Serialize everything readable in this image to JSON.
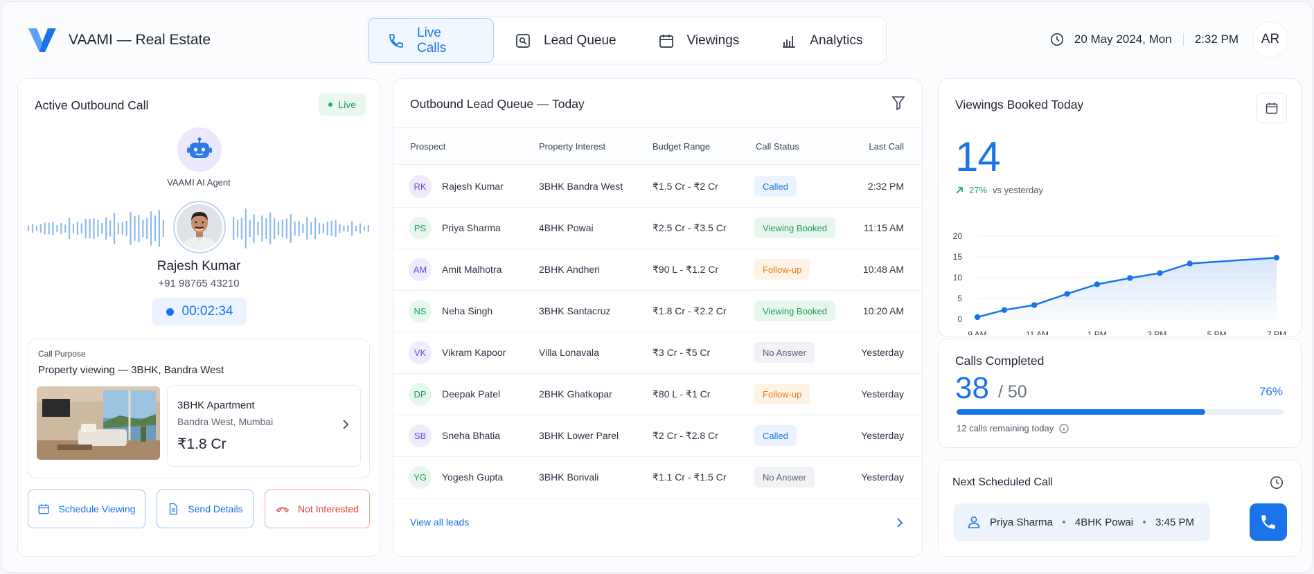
{
  "brand": {
    "name": "VAAMI — Real Estate",
    "accent": "#1a73e8"
  },
  "nav": {
    "tabs": [
      {
        "label": "Live Calls",
        "icon": "phone-icon",
        "active": true
      },
      {
        "label": "Lead Queue",
        "icon": "image-search-icon",
        "active": false
      },
      {
        "label": "Viewings",
        "icon": "calendar-icon",
        "active": false
      },
      {
        "label": "Analytics",
        "icon": "bar-chart-icon",
        "active": false
      }
    ]
  },
  "header": {
    "date": "20 May 2024, Mon",
    "time": "2:32 PM",
    "user_initials": "AR"
  },
  "active_call": {
    "title": "Active Outbound Call",
    "status": "Live",
    "agent_label": "VAAMI AI Agent",
    "caller_name": "Rajesh Kumar",
    "caller_phone": "+91 98765 43210",
    "duration": "00:02:34",
    "purpose_label": "Call Purpose",
    "purpose": "Property viewing — 3BHK, Bandra West",
    "property": {
      "title": "3BHK Apartment",
      "location": "Bandra West, Mumbai",
      "price": "₹1.8 Cr"
    },
    "actions": {
      "schedule": "Schedule Viewing",
      "send": "Send Details",
      "reject": "Not Interested"
    }
  },
  "queue": {
    "title": "Outbound Lead Queue — Today",
    "columns": [
      "Prospect",
      "Property Interest",
      "Budget Range",
      "Call Status",
      "Last Call"
    ],
    "rows": [
      {
        "initials": "RK",
        "name": "Rajesh Kumar",
        "property": "3BHK Bandra West",
        "budget": "₹1.5 Cr - ₹2 Cr",
        "status": "Called",
        "last": "2:32 PM"
      },
      {
        "initials": "PS",
        "name": "Priya Sharma",
        "property": "4BHK Powai",
        "budget": "₹2.5 Cr - ₹3.5 Cr",
        "status": "Viewing Booked",
        "last": "11:15 AM"
      },
      {
        "initials": "AM",
        "name": "Amit Malhotra",
        "property": "2BHK Andheri",
        "budget": "₹90 L - ₹1.2 Cr",
        "status": "Follow-up",
        "last": "10:48 AM"
      },
      {
        "initials": "NS",
        "name": "Neha Singh",
        "property": "3BHK Santacruz",
        "budget": "₹1.8 Cr - ₹2.2 Cr",
        "status": "Viewing Booked",
        "last": "10:20 AM"
      },
      {
        "initials": "VK",
        "name": "Vikram Kapoor",
        "property": "Villa Lonavala",
        "budget": "₹3 Cr - ₹5 Cr",
        "status": "No Answer",
        "last": "Yesterday"
      },
      {
        "initials": "DP",
        "name": "Deepak Patel",
        "property": "2BHK Ghatkopar",
        "budget": "₹80 L - ₹1 Cr",
        "status": "Follow-up",
        "last": "Yesterday"
      },
      {
        "initials": "SB",
        "name": "Sneha Bhatia",
        "property": "3BHK Lower Parel",
        "budget": "₹2 Cr - ₹2.8 Cr",
        "status": "Called",
        "last": "Yesterday"
      },
      {
        "initials": "YG",
        "name": "Yogesh Gupta",
        "property": "3BHK Borivali",
        "budget": "₹1.1 Cr - ₹1.5 Cr",
        "status": "No Answer",
        "last": "Yesterday"
      }
    ],
    "view_all": "View all leads",
    "status_colors": {
      "Called": {
        "bg": "#eaf3ff",
        "fg": "#1a73e8"
      },
      "Viewing Booked": {
        "bg": "#e8f7ee",
        "fg": "#1d9d57"
      },
      "Follow-up": {
        "bg": "#fff3e6",
        "fg": "#e07a1a"
      },
      "No Answer": {
        "bg": "#f1f2f5",
        "fg": "#5a6272"
      }
    }
  },
  "viewings": {
    "title": "Viewings Booked Today",
    "value": "14",
    "change": "27%",
    "change_label": "vs yesterday"
  },
  "chart_data": {
    "type": "area",
    "x": [
      "9 AM",
      "10 AM",
      "11 AM",
      "12 PM",
      "1 PM",
      "2 PM",
      "3 PM",
      "4 PM",
      "5 PM",
      "6 PM",
      "7 PM"
    ],
    "values": [
      0.5,
      2.2,
      3.4,
      6.1,
      8.4,
      9.9,
      11.1,
      13.4,
      14.8
    ],
    "point_hours": [
      9,
      10,
      11,
      12,
      13,
      14,
      15,
      16,
      17.5,
      19
    ],
    "tick_labels": [
      "9 AM",
      "11 AM",
      "1 PM",
      "3 PM",
      "5 PM",
      "7 PM"
    ],
    "yticks": [
      0,
      5,
      10,
      15,
      20
    ],
    "ylim": [
      0,
      20
    ],
    "grid": true,
    "color": "#1a73e8"
  },
  "calls_completed": {
    "title": "Calls Completed",
    "value": "38",
    "total": "/ 50",
    "percent_label": "76%",
    "progress": 0.76,
    "remaining": "12 calls remaining today"
  },
  "next_call": {
    "title": "Next Scheduled Call",
    "name": "Priya Sharma",
    "property": "4BHK Powai",
    "time": "3:45 PM"
  }
}
